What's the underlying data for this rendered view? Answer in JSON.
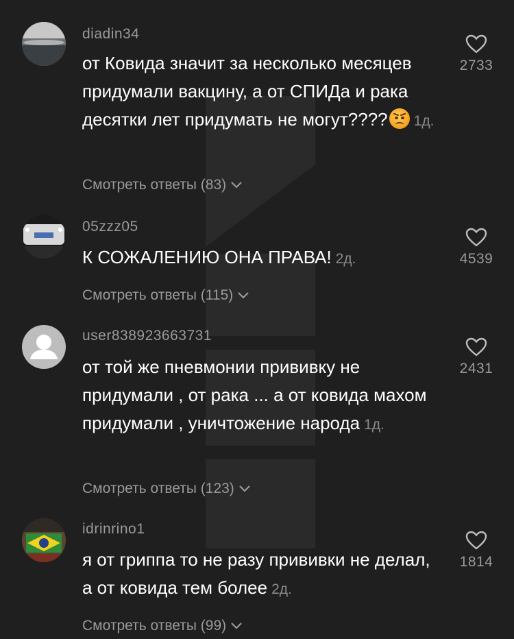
{
  "comments": [
    {
      "username": "diadin34",
      "text": "от Ковида значит за несколько месяцев придумали вакцину, а от СПИДа и рака десятки лет придумать не могут????",
      "emoji": "angry-face",
      "time": "1д.",
      "replies": "Смотреть ответы (83)",
      "likes": "2733"
    },
    {
      "username": "05zzz05",
      "text": "К СОЖАЛЕНИЮ ОНА ПРАВА!",
      "time": "2д.",
      "replies": "Смотреть ответы (115)",
      "likes": "4539"
    },
    {
      "username": "user838923663731",
      "text": "от той же пневмонии прививку не придумали , от рака ... а от ковида махом придумали , уничтожение народа",
      "time": "1д.",
      "replies": "Смотреть ответы (123)",
      "likes": "2431"
    },
    {
      "username": "idrinrino1",
      "text": "я от гриппа то не разу прививки не делал, а от ковида тем более",
      "time": "2д.",
      "replies": "Смотреть ответы (99)",
      "likes": "1814"
    }
  ],
  "colors": {
    "background": "#1f1f1f",
    "text": "#ffffff",
    "muted": "#9a9a9a"
  }
}
